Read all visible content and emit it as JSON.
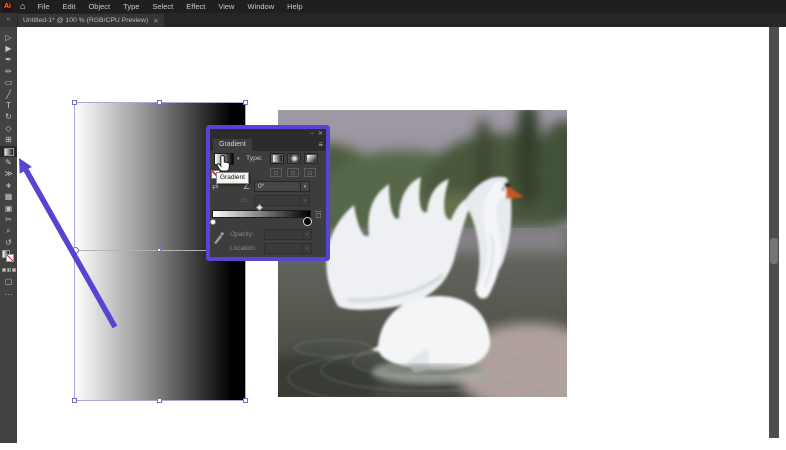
{
  "window": {
    "title_tab": "Untitled-1* @ 100 % (RGB/CPU Preview)",
    "close_glyph": "✕"
  },
  "menu_bar": {
    "logo_text": "Ai",
    "home_icon": "⌂",
    "items": [
      "File",
      "Edit",
      "Object",
      "Type",
      "Select",
      "Effect",
      "View",
      "Window",
      "Help"
    ]
  },
  "toolbar": {
    "collapse_glyph": "«",
    "tools": [
      {
        "name": "selection-tool",
        "glyph": "▷"
      },
      {
        "name": "direct-selection-tool",
        "glyph": "▶"
      },
      {
        "name": "pen-tool",
        "glyph": "✒"
      },
      {
        "name": "paintbrush-tool",
        "glyph": "✏"
      },
      {
        "name": "rectangle-tool",
        "glyph": "▭"
      },
      {
        "name": "line-segment-tool",
        "glyph": "╱"
      },
      {
        "name": "type-tool",
        "glyph": "T"
      },
      {
        "name": "rotate-tool",
        "glyph": "↻"
      },
      {
        "name": "eraser-tool",
        "glyph": "◇"
      },
      {
        "name": "scale-tool",
        "glyph": "⊞"
      },
      {
        "name": "gradient-tool",
        "type": "gradient",
        "selected": true
      },
      {
        "name": "eyedropper-tool",
        "glyph": "✎"
      },
      {
        "name": "blend-tool",
        "glyph": "≫"
      },
      {
        "name": "symbol-sprayer-tool",
        "glyph": "∗"
      },
      {
        "name": "column-graph-tool",
        "glyph": "▦"
      },
      {
        "name": "artboard-tool",
        "glyph": "▣"
      },
      {
        "name": "slice-tool",
        "glyph": "✂"
      },
      {
        "name": "zoom-tool",
        "glyph": "⌕"
      },
      {
        "name": "rotate-view-tool",
        "glyph": "↺"
      },
      {
        "name": "fill-stroke-proxy",
        "type": "fill-stroke"
      },
      {
        "name": "color-mode-buttons",
        "type": "color-row"
      },
      {
        "name": "draw-mode-button",
        "glyph": "▢"
      },
      {
        "name": "toolbar-menu",
        "glyph": "…"
      }
    ]
  },
  "gradient_panel": {
    "title": "Gradient",
    "minimize_glyph": "−",
    "close_glyph": "✕",
    "menu_glyph": "≡",
    "type_label": "Type:",
    "swatch_dropdown_glyph": "▾",
    "reverse_glyph": "⇄",
    "angle_glyph": "∠",
    "angle_value": "0°",
    "aspect_glyph": "▭",
    "opacity_label": "Opacity:",
    "location_label": "Location:",
    "tooltip_text": "Gradient",
    "dropdown_arrow": "▾"
  },
  "canvas": {
    "photo_description": "White swan with spread wings on a dark pond, blurred green trees behind",
    "gradient_rectangle": "white to black linear gradient, selected with gradient annotator"
  },
  "colors": {
    "accent_purple": "#5645d2",
    "menubar_bg": "#1f1f1f",
    "toolbar_bg": "#424242",
    "panel_bg": "#3d3d3d",
    "artboard": "#ffffff",
    "beak_orange": "#c8571f"
  }
}
